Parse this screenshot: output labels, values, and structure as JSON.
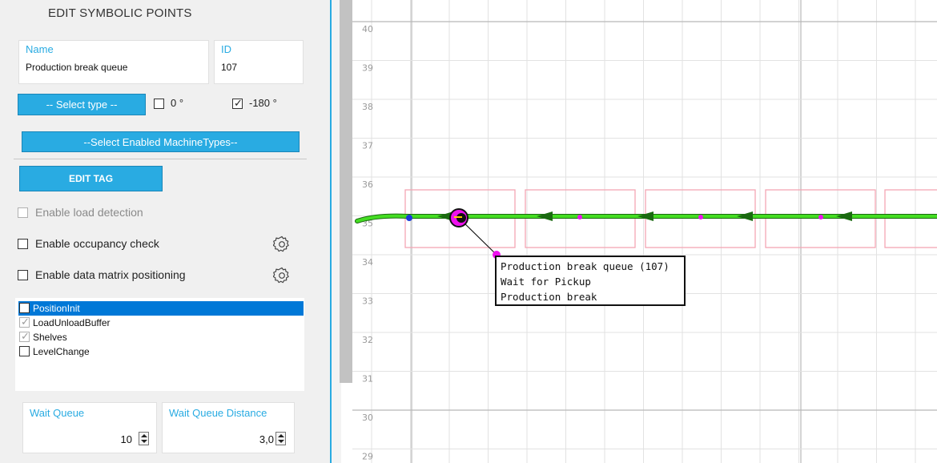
{
  "panel": {
    "title": "EDIT SYMBOLIC POINTS",
    "name_label": "Name",
    "name_value": "Production break queue",
    "id_label": "ID",
    "id_value": "107",
    "select_type": "-- Select type --",
    "angle_0": "0 °",
    "angle_0_checked": false,
    "angle_180": "-180 °",
    "angle_180_checked": true,
    "select_machine_types": "--Select Enabled MachineTypes--",
    "edit_tag": "EDIT TAG",
    "enable_load_detection": "Enable load detection",
    "enable_occupancy_check": "Enable occupancy check",
    "enable_data_matrix": "Enable data matrix positioning",
    "tags": [
      {
        "label": "PositionInit",
        "checked": false,
        "selected": true
      },
      {
        "label": "LoadUnloadBuffer",
        "checked": true,
        "selected": false
      },
      {
        "label": "Shelves",
        "checked": true,
        "selected": false
      },
      {
        "label": "LevelChange",
        "checked": false,
        "selected": false
      }
    ],
    "wait_queue_label": "Wait Queue",
    "wait_queue_value": "10",
    "wait_queue_distance_label": "Wait Queue Distance",
    "wait_queue_distance_value": "3,0"
  },
  "map": {
    "y_axis_labels": [
      "40",
      "39",
      "38",
      "37",
      "36",
      "35",
      "34",
      "33",
      "32",
      "31",
      "30",
      "29"
    ],
    "tooltip": {
      "line1": "Production break queue (107)",
      "line2": "Wait for Pickup",
      "line3": "Production break"
    },
    "colors": {
      "path": "#44dd22",
      "path_dark": "#1a6a10",
      "box": "#f4a6b4",
      "marker": "#ee11ee",
      "accent": "#29abe2"
    }
  }
}
